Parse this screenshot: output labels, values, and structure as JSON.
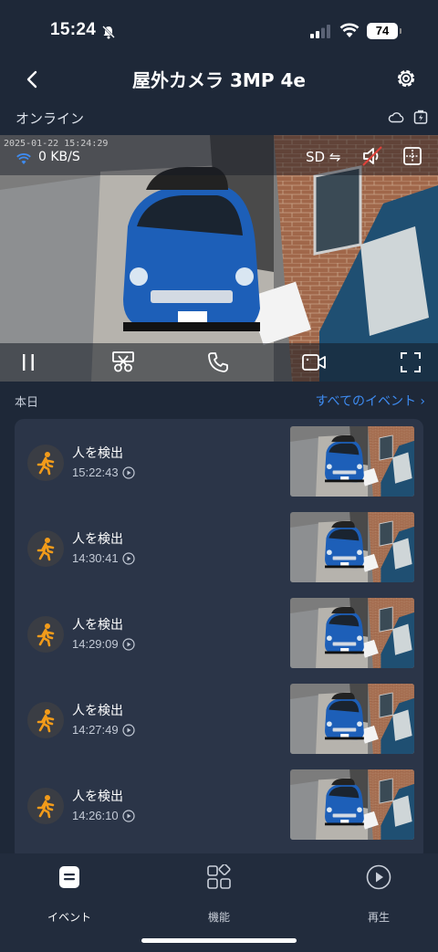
{
  "status_bar": {
    "time": "15:24",
    "battery": "74"
  },
  "nav": {
    "title": "屋外カメラ 3MP 4e",
    "back_icon": "chevron-left-icon",
    "settings_icon": "gear-icon"
  },
  "status": {
    "online": "オンライン"
  },
  "video": {
    "timestamp": "2025-01-22 15:24:29",
    "speed": "0 KB/S",
    "sd": "SD ⇋"
  },
  "events": {
    "today": "本日",
    "all_events": "すべてのイベント ›",
    "items": [
      {
        "title": "人を検出",
        "time": "15:22:43"
      },
      {
        "title": "人を検出",
        "time": "14:30:41"
      },
      {
        "title": "人を検出",
        "time": "14:29:09"
      },
      {
        "title": "人を検出",
        "time": "14:27:49"
      },
      {
        "title": "人を検出",
        "time": "14:26:10"
      }
    ]
  },
  "tabs": [
    {
      "label": "イベント",
      "icon": "event-list-icon"
    },
    {
      "label": "機能",
      "icon": "apps-grid-icon"
    },
    {
      "label": "再生",
      "icon": "play-circle-icon"
    }
  ],
  "colors": {
    "background": "#1e2838",
    "card": "#2b3548",
    "accent": "#3e8cf2",
    "event_icon": "#f29b1a"
  }
}
